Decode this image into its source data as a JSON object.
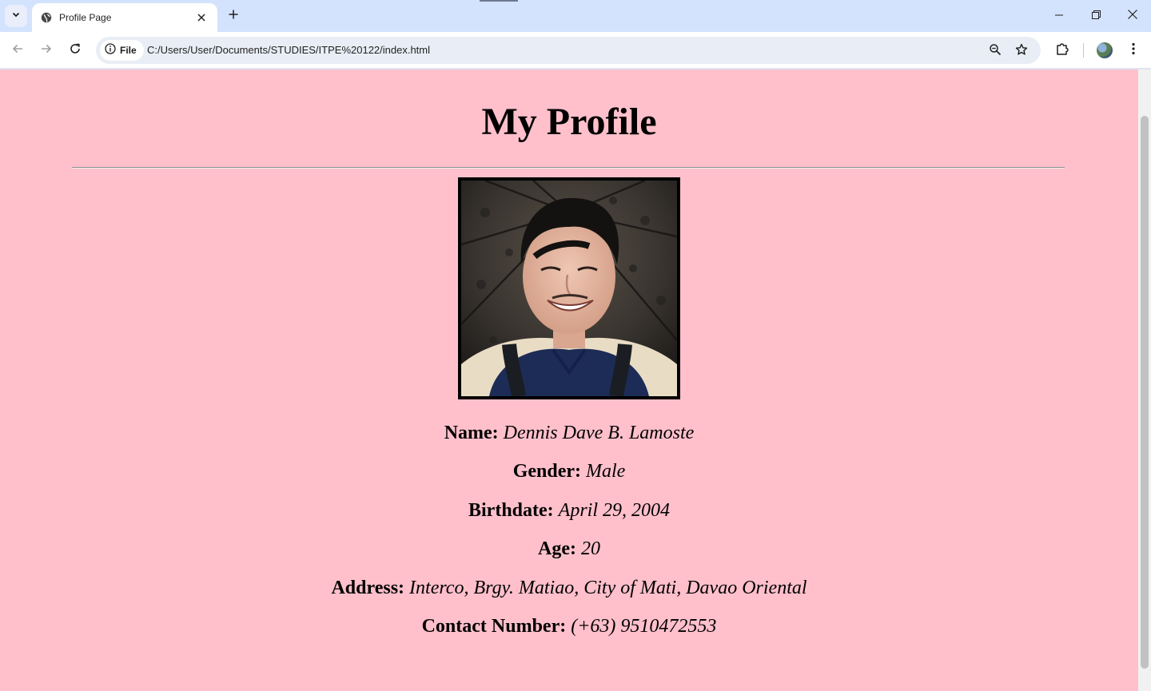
{
  "browser": {
    "tab_title": "Profile Page",
    "chip_label": "File",
    "url": "C:/Users/User/Documents/STUDIES/ITPE%20122/index.html"
  },
  "page": {
    "title": "My Profile",
    "background": "#ffc0cb",
    "fields": [
      {
        "label": "Name:",
        "value": "Dennis Dave B. Lamoste"
      },
      {
        "label": "Gender:",
        "value": "Male"
      },
      {
        "label": "Birthdate:",
        "value": "April 29, 2004"
      },
      {
        "label": "Age:",
        "value": "20"
      },
      {
        "label": "Address:",
        "value": "Interco, Brgy. Matiao, City of Mati, Davao Oriental"
      },
      {
        "label": "Contact Number:",
        "value": "(+63) 9510472553"
      }
    ]
  },
  "icons": {
    "tab_search": "chevron-down-icon",
    "favicon": "globe-icon",
    "tab_close": "close-icon",
    "new_tab": "plus-icon",
    "back": "arrow-left-icon",
    "forward": "arrow-right-icon",
    "reload": "reload-icon",
    "site_info": "info-icon",
    "zoom": "zoom-icon",
    "bookmark": "star-icon",
    "extensions": "puzzle-icon",
    "menu": "kebab-menu-icon"
  }
}
